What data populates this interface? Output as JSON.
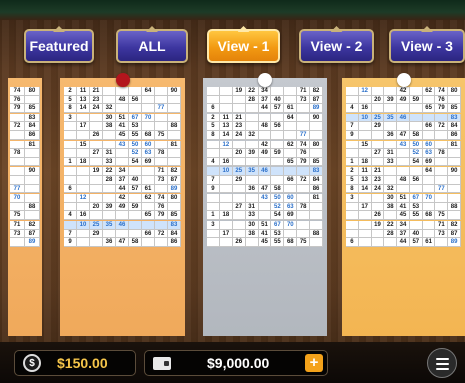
{
  "tabs": [
    {
      "label": "Featured",
      "active": false
    },
    {
      "label": "ALL",
      "active": false
    },
    {
      "label": "View - 1",
      "active": true
    },
    {
      "label": "View - 2",
      "active": false
    },
    {
      "label": "View - 3",
      "active": false
    }
  ],
  "colors": {
    "tab": "#3d36a0",
    "tab_active": "#f29a12",
    "balance_gold": "#f6c64a",
    "plus": "#f4a21a",
    "highlight": "#cfe3fb",
    "highlight_text": "#2a6fc9"
  },
  "cards": [
    {
      "name": "left-partial",
      "color": "orange",
      "ball": null,
      "rows": [
        [
          "74",
          "80"
        ],
        [
          "76",
          ""
        ],
        [
          "79",
          "85"
        ],
        [
          "",
          "83"
        ],
        [
          "72",
          "84"
        ],
        [
          "",
          "86"
        ],
        [
          "",
          "81"
        ],
        [
          "78",
          ""
        ],
        [
          "",
          ""
        ],
        [
          "",
          "90"
        ],
        [
          "",
          ""
        ],
        [
          "77",
          ""
        ],
        [
          "70",
          ""
        ],
        [
          "",
          "88"
        ],
        [
          "75",
          ""
        ],
        [
          "71",
          "82"
        ],
        [
          "73",
          "87"
        ],
        [
          "",
          "89"
        ]
      ]
    },
    {
      "name": "red",
      "color": "orange",
      "ball": "#b3151d",
      "rows": [
        [
          "2",
          "11",
          "21",
          "",
          "",
          "",
          "64",
          "",
          "90"
        ],
        [
          "5",
          "13",
          "23",
          "",
          "48",
          "56",
          "",
          "",
          ""
        ],
        [
          "8",
          "14",
          "24",
          "32",
          "",
          "",
          "",
          "77",
          ""
        ],
        [
          "3",
          "",
          "",
          "30",
          "51",
          "67",
          "70",
          "",
          ""
        ],
        [
          "",
          "17",
          "",
          "38",
          "41",
          "53",
          "",
          "",
          "88"
        ],
        [
          "",
          "",
          "26",
          "",
          "45",
          "55",
          "68",
          "75",
          ""
        ],
        [
          "",
          "15",
          "",
          "",
          "43",
          "50",
          "60",
          "",
          "81"
        ],
        [
          "",
          "",
          "27",
          "31",
          "",
          "52",
          "63",
          "78",
          ""
        ],
        [
          "1",
          "18",
          "",
          "33",
          "",
          "54",
          "69",
          "",
          ""
        ],
        [
          "",
          "",
          "19",
          "22",
          "34",
          "",
          "",
          "71",
          "82"
        ],
        [
          "",
          "",
          "",
          "28",
          "37",
          "40",
          "",
          "73",
          "87"
        ],
        [
          "6",
          "",
          "",
          "",
          "44",
          "57",
          "61",
          "",
          "89"
        ],
        [
          "",
          "12",
          "",
          "",
          "42",
          "",
          "62",
          "74",
          "80"
        ],
        [
          "",
          "",
          "20",
          "39",
          "49",
          "59",
          "",
          "76",
          ""
        ],
        [
          "4",
          "16",
          "",
          "",
          "",
          "",
          "65",
          "79",
          "85"
        ],
        [
          "",
          "10",
          "25",
          "35",
          "46",
          "",
          "",
          "",
          "83"
        ],
        [
          "7",
          "",
          "29",
          "",
          "",
          "",
          "66",
          "72",
          "84"
        ],
        [
          "9",
          "",
          "",
          "36",
          "47",
          "58",
          "",
          "",
          "86"
        ]
      ]
    },
    {
      "name": "white",
      "color": "gray",
      "ball": "#ffffff",
      "rows": [
        [
          "",
          "",
          "19",
          "22",
          "34",
          "",
          "",
          "71",
          "82"
        ],
        [
          "",
          "",
          "",
          "28",
          "37",
          "40",
          "",
          "73",
          "87"
        ],
        [
          "6",
          "",
          "",
          "",
          "44",
          "57",
          "61",
          "",
          "89"
        ],
        [
          "2",
          "11",
          "21",
          "",
          "",
          "",
          "64",
          "",
          "90"
        ],
        [
          "5",
          "13",
          "23",
          "",
          "48",
          "56",
          "",
          "",
          ""
        ],
        [
          "8",
          "14",
          "24",
          "32",
          "",
          "",
          "",
          "77",
          ""
        ],
        [
          "",
          "12",
          "",
          "",
          "42",
          "",
          "62",
          "74",
          "80"
        ],
        [
          "",
          "",
          "20",
          "39",
          "49",
          "59",
          "",
          "76",
          ""
        ],
        [
          "4",
          "16",
          "",
          "",
          "",
          "",
          "65",
          "79",
          "85"
        ],
        [
          "",
          "10",
          "25",
          "35",
          "46",
          "",
          "",
          "",
          "83"
        ],
        [
          "7",
          "",
          "29",
          "",
          "",
          "",
          "66",
          "72",
          "84"
        ],
        [
          "9",
          "",
          "",
          "36",
          "47",
          "58",
          "",
          "",
          "86"
        ],
        [
          "",
          "",
          "",
          "",
          "43",
          "50",
          "60",
          "",
          "81"
        ],
        [
          "",
          "",
          "27",
          "31",
          "",
          "52",
          "63",
          "78",
          ""
        ],
        [
          "1",
          "18",
          "",
          "33",
          "",
          "54",
          "69",
          "",
          ""
        ],
        [
          "3",
          "",
          "",
          "30",
          "51",
          "67",
          "70",
          "",
          ""
        ],
        [
          "",
          "17",
          "",
          "38",
          "41",
          "53",
          "",
          "",
          "88"
        ],
        [
          "",
          "",
          "26",
          "",
          "45",
          "55",
          "68",
          "75",
          ""
        ]
      ]
    },
    {
      "name": "right",
      "color": "lorange",
      "ball": "#ffffff",
      "rows": [
        [
          "",
          "12",
          "",
          "",
          "42",
          "",
          "62",
          "74",
          "80"
        ],
        [
          "",
          "",
          "20",
          "39",
          "49",
          "59",
          "",
          "76",
          ""
        ],
        [
          "4",
          "16",
          "",
          "",
          "",
          "",
          "65",
          "79",
          "85"
        ],
        [
          "",
          "10",
          "25",
          "35",
          "46",
          "",
          "",
          "",
          "83"
        ],
        [
          "7",
          "",
          "29",
          "",
          "",
          "",
          "66",
          "72",
          "84"
        ],
        [
          "9",
          "",
          "",
          "36",
          "47",
          "58",
          "",
          "",
          "86"
        ],
        [
          "",
          "15",
          "",
          "",
          "43",
          "50",
          "60",
          "",
          "81"
        ],
        [
          "",
          "",
          "27",
          "31",
          "",
          "52",
          "63",
          "78",
          ""
        ],
        [
          "1",
          "18",
          "",
          "33",
          "",
          "54",
          "69",
          "",
          ""
        ],
        [
          "2",
          "11",
          "21",
          "",
          "",
          "",
          "64",
          "",
          "90"
        ],
        [
          "5",
          "13",
          "23",
          "",
          "48",
          "56",
          "",
          "",
          ""
        ],
        [
          "8",
          "14",
          "24",
          "32",
          "",
          "",
          "",
          "77",
          ""
        ],
        [
          "3",
          "",
          "",
          "30",
          "51",
          "67",
          "70",
          "",
          ""
        ],
        [
          "",
          "17",
          "",
          "38",
          "41",
          "53",
          "",
          "",
          "88"
        ],
        [
          "",
          "",
          "26",
          "",
          "45",
          "55",
          "68",
          "75",
          ""
        ],
        [
          "",
          "",
          "19",
          "22",
          "34",
          "",
          "",
          "71",
          "82"
        ],
        [
          "",
          "",
          "",
          "28",
          "37",
          "40",
          "",
          "73",
          "87"
        ],
        [
          "6",
          "",
          "",
          "",
          "44",
          "57",
          "61",
          "",
          "89"
        ]
      ]
    }
  ],
  "highlight_numbers": [
    "10",
    "25",
    "35",
    "46",
    "83",
    "43",
    "50",
    "60",
    "89",
    "77"
  ],
  "balance": {
    "chip_label": "$",
    "amount": "$150.00"
  },
  "wallet": {
    "amount": "$9,000.00",
    "plus_label": "+"
  },
  "icons": {
    "chip": "casino-chip-icon",
    "wallet": "wallet-icon",
    "plus": "plus-icon",
    "menu": "hamburger-menu-icon"
  }
}
